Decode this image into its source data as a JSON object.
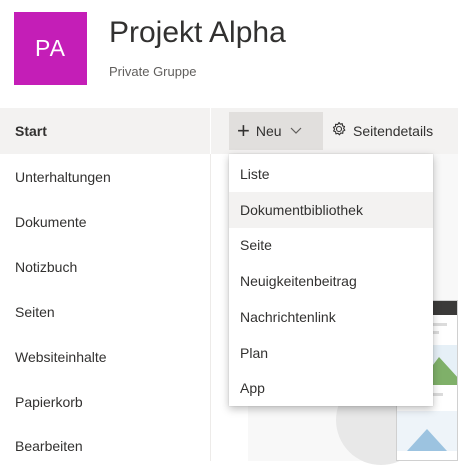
{
  "site": {
    "logo_initials": "PA",
    "logo_color": "#c41eb7",
    "title": "Projekt Alpha",
    "subtitle": "Private Gruppe"
  },
  "sidebar": {
    "items": [
      {
        "label": "Start",
        "selected": true
      },
      {
        "label": "Unterhaltungen"
      },
      {
        "label": "Dokumente"
      },
      {
        "label": "Notizbuch"
      },
      {
        "label": "Seiten"
      },
      {
        "label": "Websiteinhalte"
      },
      {
        "label": "Papierkorb"
      },
      {
        "label": "Bearbeiten"
      }
    ]
  },
  "commandbar": {
    "new_label": "Neu",
    "new_icon": "plus-icon",
    "new_chevron_icon": "chevron-down-icon",
    "details_label": "Seitendetails",
    "details_icon": "gear-icon"
  },
  "new_menu": {
    "hovered_index": 1,
    "items": [
      {
        "label": "Liste"
      },
      {
        "label": "Dokumentbibliothek"
      },
      {
        "label": "Seite"
      },
      {
        "label": "Neuigkeitenbeitrag"
      },
      {
        "label": "Nachrichtenlink"
      },
      {
        "label": "Plan"
      },
      {
        "label": "App"
      }
    ]
  },
  "colors": {
    "accent": "#0078d4",
    "hover_bg": "#f3f2f1"
  }
}
